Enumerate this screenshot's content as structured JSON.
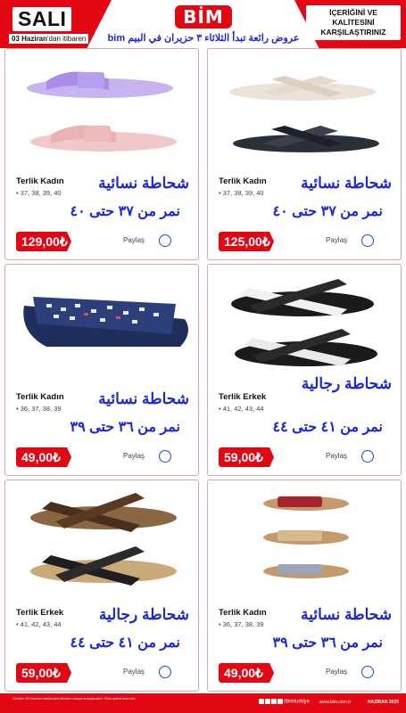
{
  "header": {
    "day": "SALI",
    "since_bold": "03 Haziran",
    "since_rest": "'dan itibaren",
    "logo": "BİM",
    "promo_ar": "عروض رائعة تبدأ الثلاثاء ٣ حزيران في البيم bim",
    "compare_line1": "İÇERİĞİNİ VE",
    "compare_line2": "KALİTESİNİ",
    "compare_line3": "KARŞILAŞTIRINIZ"
  },
  "products": [
    {
      "name": "Terlik Kadın",
      "sizes": "• 37, 38, 39, 40",
      "ar_title": "شحاطة نسائية",
      "ar_sizes": "نمر من ٣٧ حتى ٤٠",
      "price": "129,00₺",
      "share": "Paylaş",
      "image": "lilac-and-pink-slides"
    },
    {
      "name": "Terlik Kadın",
      "sizes": "• 37, 38, 39, 40",
      "ar_title": "شحاطة نسائية",
      "ar_sizes": "نمر من ٣٧ حتى ٤٠",
      "price": "125,00₺",
      "share": "Paylaş",
      "image": "cream-and-black-cross-slides"
    },
    {
      "name": "Terlik Kadın",
      "sizes": "• 36, 37, 38, 39",
      "ar_title": "شحاطة نسائية",
      "ar_sizes": "نمر من ٣٦ حتى ٣٩",
      "price": "49,00₺",
      "share": "Paylaş",
      "image": "navy-patterned-slide"
    },
    {
      "name": "Terlik Erkek",
      "sizes": "• 41, 42, 43, 44",
      "ar_title": "شحاطة رجالية",
      "ar_sizes": "نمر من ٤١ حتى ٤٤",
      "price": "59,00₺",
      "share": "Paylaş",
      "image": "black-white-cross-slides"
    },
    {
      "name": "Terlik Erkek",
      "sizes": "• 41, 42, 43, 44",
      "ar_title": "شحاطة رجالية",
      "ar_sizes": "نمر من ٤١ حتى ٤٤",
      "price": "59,00₺",
      "share": "Paylaş",
      "image": "brown-and-black-leather-slides"
    },
    {
      "name": "Terlik Kadın",
      "sizes": "• 36, 37, 38, 39",
      "ar_title": "شحاطة نسائية",
      "ar_sizes": "نمر من ٣٦ حتى ٣٩",
      "price": "49,00₺",
      "share": "Paylaş",
      "image": "three-flat-sandals"
    }
  ],
  "footer": {
    "note": "Ürünler 03 Haziran tarihinden itibaren satışa sunulacaktır. Stok adedi sınırlıdır.",
    "social": "/bimturkiye",
    "site": "www.bim.com.tr",
    "date": "HAZİRAN 2025"
  },
  "colors": {
    "brand_red": "#e30613",
    "arabic_blue": "#1d27d8"
  }
}
